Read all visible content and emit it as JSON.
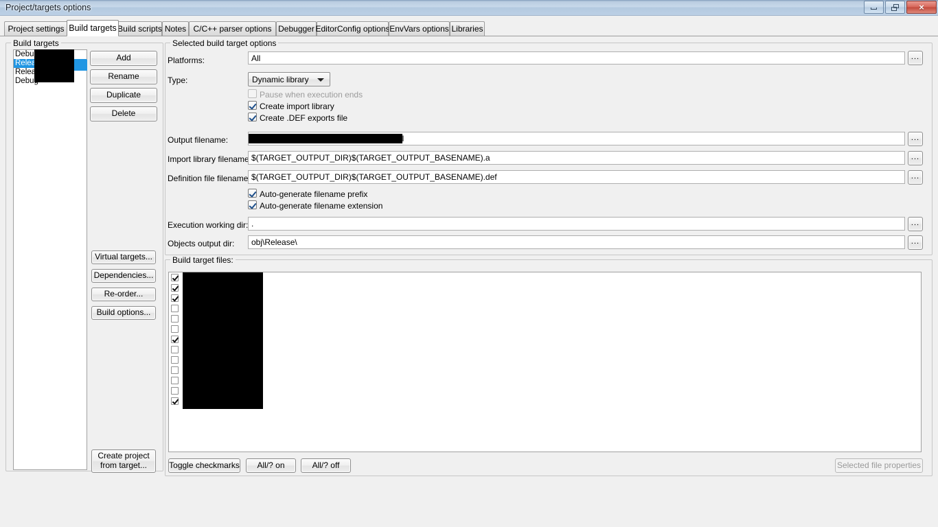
{
  "window": {
    "title": "Project/targets options",
    "controls": {
      "minimize": "minimize-button",
      "restore": "restore-button",
      "close": "×"
    }
  },
  "tabs": [
    {
      "label": "Project settings",
      "active": false
    },
    {
      "label": "Build targets",
      "active": true
    },
    {
      "label": "Build scripts",
      "active": false
    },
    {
      "label": "Notes",
      "active": false
    },
    {
      "label": "C/C++ parser options",
      "active": false
    },
    {
      "label": "Debugger",
      "active": false
    },
    {
      "label": "EditorConfig options",
      "active": false
    },
    {
      "label": "EnvVars options",
      "active": false
    },
    {
      "label": "Libraries",
      "active": false
    }
  ],
  "build_targets_group": {
    "legend": "Build targets",
    "items": [
      {
        "label": "Debug",
        "selected": false,
        "redacted": true
      },
      {
        "label": "Release",
        "selected": true,
        "redacted": true
      },
      {
        "label": "Release",
        "selected": false,
        "redacted": true
      },
      {
        "label": "Debug",
        "selected": false,
        "redacted": true
      }
    ],
    "buttons": [
      {
        "label": "Add"
      },
      {
        "label": "Rename"
      },
      {
        "label": "Duplicate"
      },
      {
        "label": "Delete"
      }
    ],
    "secondary_buttons": [
      {
        "label": "Virtual targets..."
      },
      {
        "label": "Dependencies..."
      },
      {
        "label": "Re-order..."
      },
      {
        "label": "Build options..."
      }
    ],
    "create_project_button": "Create project\nfrom target..."
  },
  "options_group": {
    "legend": "Selected build target options",
    "platforms": {
      "label": "Platforms:",
      "value": "All",
      "browse": "..."
    },
    "type": {
      "label": "Type:",
      "value": "Dynamic library"
    },
    "checkboxes": [
      {
        "label": "Pause when execution ends",
        "checked": false,
        "enabled": false
      },
      {
        "label": "Create import library",
        "checked": true,
        "enabled": true
      },
      {
        "label": "Create .DEF exports file",
        "checked": true,
        "enabled": true
      }
    ],
    "output_filename": {
      "label": "Output filename:",
      "value": ".dll",
      "redacted": true,
      "browse": "..."
    },
    "import_library_filename": {
      "label": "Import library filename:",
      "value": "$(TARGET_OUTPUT_DIR)$(TARGET_OUTPUT_BASENAME).a",
      "browse": "..."
    },
    "definition_file_filename": {
      "label": "Definition file filename:",
      "value": "$(TARGET_OUTPUT_DIR)$(TARGET_OUTPUT_BASENAME).def",
      "browse": "..."
    },
    "autogen_checkboxes": [
      {
        "label": "Auto-generate filename prefix",
        "checked": true
      },
      {
        "label": "Auto-generate filename extension",
        "checked": true
      }
    ],
    "execution_working_dir": {
      "label": "Execution working dir:",
      "value": ".",
      "browse": "..."
    },
    "objects_output_dir": {
      "label": "Objects output dir:",
      "value": "obj\\Release\\",
      "browse": "..."
    }
  },
  "build_target_files_group": {
    "legend": "Build target files:",
    "rows": [
      {
        "checked": true,
        "redacted": true
      },
      {
        "checked": true,
        "redacted": true
      },
      {
        "checked": true,
        "redacted": true
      },
      {
        "checked": false,
        "redacted": true
      },
      {
        "checked": false,
        "redacted": true
      },
      {
        "checked": false,
        "redacted": true
      },
      {
        "checked": true,
        "redacted": true
      },
      {
        "checked": false,
        "redacted": true
      },
      {
        "checked": false,
        "redacted": true
      },
      {
        "checked": false,
        "redacted": true
      },
      {
        "checked": false,
        "redacted": true
      },
      {
        "checked": false,
        "redacted": true
      },
      {
        "checked": true,
        "redacted": true
      }
    ],
    "buttons": [
      {
        "label": "Toggle checkmarks",
        "enabled": true
      },
      {
        "label": "All/? on",
        "enabled": true
      },
      {
        "label": "All/? off",
        "enabled": true
      }
    ],
    "selected_file_properties": {
      "label": "Selected file properties",
      "enabled": false
    }
  },
  "colors": {
    "selection": "#2196e3",
    "titlebar_top": "#8fa8c4",
    "titlebar_bottom": "#bcd0e5",
    "close_button": "#c24a3c",
    "dialog_bg": "#f0f0f0",
    "field_bg": "#ffffff"
  }
}
